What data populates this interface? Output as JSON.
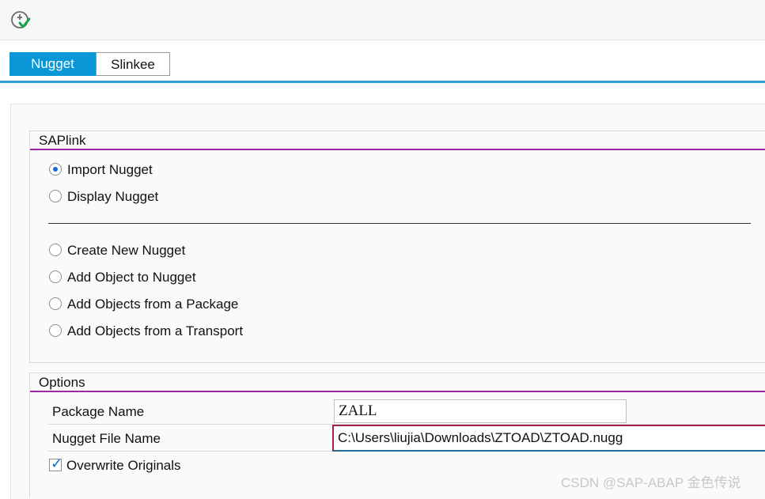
{
  "toolbar": {
    "execute_icon": "execute-check-icon"
  },
  "tabs": [
    {
      "label": "Nugget",
      "active": true
    },
    {
      "label": "Slinkee",
      "active": false
    }
  ],
  "saplink": {
    "title": "SAPlink",
    "options_top": [
      {
        "label": "Import Nugget",
        "checked": true
      },
      {
        "label": "Display Nugget",
        "checked": false
      }
    ],
    "options_bottom": [
      {
        "label": "Create New Nugget",
        "checked": false
      },
      {
        "label": "Add Object to Nugget",
        "checked": false
      },
      {
        "label": "Add Objects from a Package",
        "checked": false
      },
      {
        "label": "Add Objects from a Transport",
        "checked": false
      }
    ]
  },
  "options": {
    "title": "Options",
    "package_name_label": "Package Name",
    "package_name_value": "ZALL",
    "nugget_file_label": "Nugget File Name",
    "nugget_file_value": "C:\\Users\\liujia\\Downloads\\ZTOAD\\ZTOAD.nugg",
    "overwrite_label": "Overwrite Originals",
    "overwrite_checked": true
  },
  "watermark": "CSDN @SAP-ABAP 金色传说",
  "colors": {
    "accent": "#0a97d6",
    "group_rule": "#9b2aa0",
    "check": "#0a6ed1"
  }
}
